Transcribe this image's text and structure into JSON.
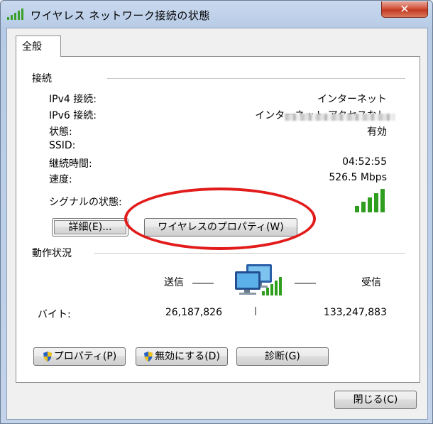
{
  "window": {
    "title": "ワイヤレス ネットワーク接続の状態",
    "close_glyph": "✕"
  },
  "tabs": [
    {
      "label": "全般"
    }
  ],
  "connection": {
    "section_title": "接続",
    "rows": [
      {
        "label": "IPv4 接続:",
        "value": "インターネット"
      },
      {
        "label": "IPv6 接続:",
        "value": "インターネット アクセスなし"
      },
      {
        "label": "状態:",
        "value": "有効"
      },
      {
        "label": "SSID:",
        "value": ""
      },
      {
        "label": "継続時間:",
        "value": "04:52:55"
      },
      {
        "label": "速度:",
        "value": "526.5 Mbps"
      }
    ],
    "signal_label": "シグナルの状態:",
    "signal_bars": 5,
    "details_button": "詳細(E)...",
    "wireless_props_button": "ワイヤレスのプロパティ(W)"
  },
  "activity": {
    "section_title": "動作状況",
    "sent_label": "送信",
    "received_label": "受信",
    "bytes_label": "バイト:",
    "bytes_sent": "26,187,826",
    "bytes_received": "133,247,883"
  },
  "buttons": {
    "properties": "プロパティ(P)",
    "disable": "無効にする(D)",
    "diagnose": "診断(G)",
    "close": "閉じる(C)"
  },
  "colors": {
    "signal_green": "#2f9e1f",
    "annotation_red": "#e21b1b"
  }
}
